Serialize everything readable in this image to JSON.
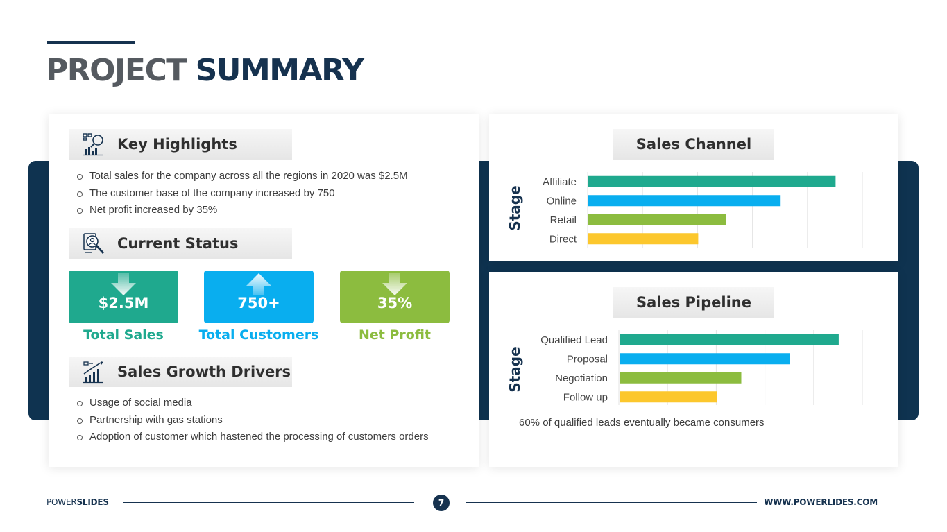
{
  "header": {
    "title_part1": "PROJECT",
    "title_part2": "SUMMARY"
  },
  "left_panel": {
    "key_highlights": {
      "heading": "Key Highlights",
      "icon": "analytics-icon",
      "items": [
        "Total sales for the company across all the regions in 2020 was $2.5M",
        "The customer base of the company increased by 750",
        "Net profit increased by 35%"
      ]
    },
    "current_status": {
      "heading": "Current Status",
      "icon": "user-search-icon",
      "kpis": [
        {
          "value": "$2.5M",
          "label": "Total Sales",
          "direction": "down",
          "color": "#1fa98e"
        },
        {
          "value": "750+",
          "label": "Total Customers",
          "direction": "up",
          "color": "#09aeef"
        },
        {
          "value": "35%",
          "label": "Net Profit",
          "direction": "down",
          "color": "#8cbc3f"
        }
      ]
    },
    "sales_growth_drivers": {
      "heading": "Sales Growth Drivers",
      "icon": "growth-chart-icon",
      "items": [
        "Usage of social media",
        "Partnership with gas stations",
        "Adoption of customer which hastened the processing of customers orders"
      ]
    }
  },
  "chart_data": [
    {
      "type": "bar",
      "orientation": "horizontal",
      "title": "Sales Channel",
      "ylabel": "Stage",
      "categories": [
        "Affiliate",
        "Online",
        "Retail",
        "Direct"
      ],
      "values": [
        90,
        70,
        50,
        40
      ],
      "xlim": [
        0,
        100
      ],
      "colors": [
        "#1fa98e",
        "#09aeef",
        "#8cbc3f",
        "#fcc72d"
      ],
      "grid": true,
      "legend": "none"
    },
    {
      "type": "bar",
      "orientation": "horizontal",
      "title": "Sales Pipeline",
      "ylabel": "Stage",
      "categories": [
        "Qualified Lead",
        "Proposal",
        "Negotiation",
        "Follow up"
      ],
      "values": [
        90,
        70,
        50,
        40
      ],
      "xlim": [
        0,
        100
      ],
      "colors": [
        "#1fa98e",
        "#09aeef",
        "#8cbc3f",
        "#fcc72d"
      ],
      "grid": true,
      "legend": "none",
      "annotation": "60% of qualified leads eventually became consumers"
    }
  ],
  "footer": {
    "brand_part1": "POWER",
    "brand_part2": "SLIDES",
    "page_number": "7",
    "url": "WWW.POWERLIDES.COM"
  }
}
